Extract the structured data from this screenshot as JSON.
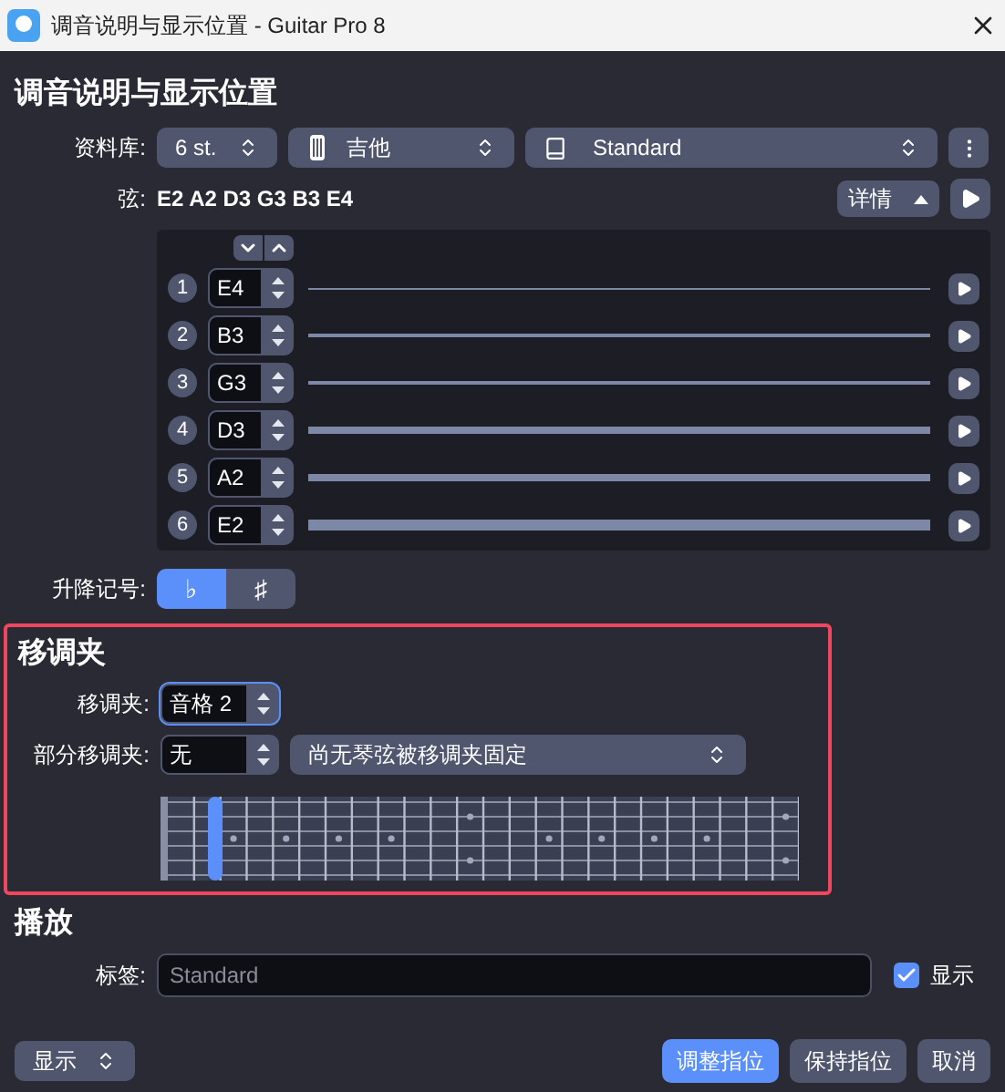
{
  "window": {
    "title": "调音说明与显示位置 - Guitar Pro 8"
  },
  "tuning": {
    "heading": "调音说明与显示位置",
    "library_label": "资料库:",
    "strings_count": "6 st.",
    "instrument": "吉他",
    "preset": "Standard",
    "strings_label": "弦:",
    "strings_summary": "E2 A2 D3 G3 B3 E4",
    "details_button": "详情"
  },
  "strings": [
    {
      "number": "1",
      "note": "E4"
    },
    {
      "number": "2",
      "note": "B3"
    },
    {
      "number": "3",
      "note": "G3"
    },
    {
      "number": "4",
      "note": "D3"
    },
    {
      "number": "5",
      "note": "A2"
    },
    {
      "number": "6",
      "note": "E2"
    }
  ],
  "accidentals": {
    "label": "升降记号:",
    "options": [
      {
        "symbol": "♭",
        "selected": true
      },
      {
        "symbol": "♯",
        "selected": false
      }
    ]
  },
  "capo": {
    "heading": "移调夹",
    "capo_label": "移调夹:",
    "capo_value": "音格 2",
    "partial_label": "部分移调夹:",
    "partial_value": "无",
    "partial_strings": "尚无琴弦被移调夹固定"
  },
  "playback": {
    "heading": "播放",
    "label_label": "标签:",
    "label_placeholder": "Standard",
    "show": {
      "label": "显示",
      "checked": true
    }
  },
  "footer": {
    "display_button": "显示",
    "buttons": [
      {
        "label": "调整指位",
        "kind": "primary"
      },
      {
        "label": "保持指位",
        "kind": "secondary"
      },
      {
        "label": "取消",
        "kind": "secondary"
      }
    ]
  }
}
